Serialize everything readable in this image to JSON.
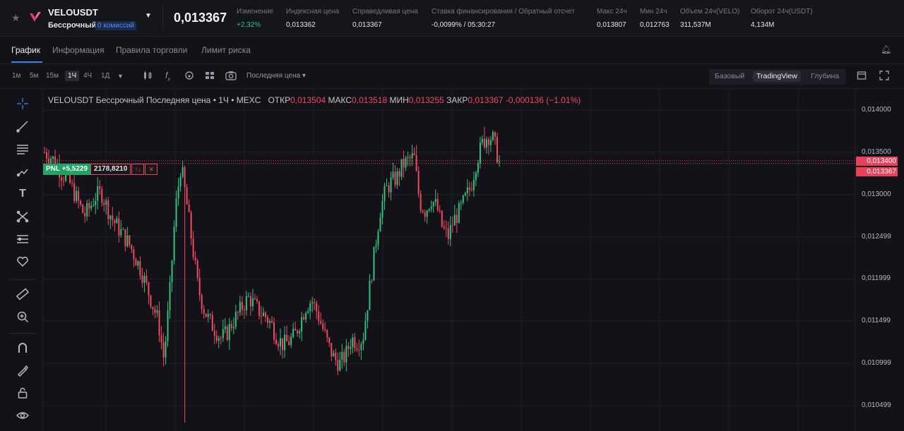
{
  "header": {
    "symbol": "VELOUSDT",
    "contract_type": "Бессрочный",
    "fee_badge": "0 комиссий",
    "last_price": "0,013367",
    "stats": [
      {
        "label": "Изменение",
        "value": "+2,32%",
        "color": "#2ec37f"
      },
      {
        "label": "Индексная цена",
        "value": "0,013362"
      },
      {
        "label": "Справедливая цена",
        "value": "0,013367"
      },
      {
        "label": "Ставка финансирования / Обратный отсчет",
        "value": "-0,0099% / 05:30:27"
      },
      {
        "label": "Макс 24ч",
        "value": "0,013807"
      },
      {
        "label": "Мин 24ч",
        "value": "0,012763"
      },
      {
        "label": "Объем 24ч(VELO)",
        "value": "311,537M"
      },
      {
        "label": "Оборот 24ч(USDT)",
        "value": "4,134M"
      }
    ]
  },
  "tabs": [
    "График",
    "Информация",
    "Правила торговли",
    "Лимит риска"
  ],
  "active_tab": "График",
  "timeframes": [
    "1м",
    "5м",
    "15м",
    "1Ч",
    "4Ч",
    "1Д"
  ],
  "active_timeframe": "1Ч",
  "price_type": "Последняя цена",
  "views": [
    "Базовый",
    "TradingView",
    "Глубина"
  ],
  "active_view": "TradingView",
  "legend": {
    "title": "VELOUSDT Бессрочный Последняя цена • 1Ч • MEXC",
    "open_label": "ОТКР",
    "open": "0,013504",
    "high_label": "МАКС",
    "high": "0,013518",
    "low_label": "МИН",
    "low": "0,013255",
    "close_label": "ЗАКР",
    "close": "0,013367",
    "change": "-0,000136 (−1.01%)"
  },
  "position": {
    "pnl": "PNL +5,5229",
    "qty": "2178,8210",
    "reverse_icon": "↑↓",
    "close_icon": "✕"
  },
  "price_tags": {
    "entry": "0,013400",
    "last": "0,013367"
  },
  "colors": {
    "up": "#2ec37f",
    "down": "#f2495f",
    "accent": "#3b82f6",
    "tag": "#e8425a"
  },
  "chart_data": {
    "type": "candlestick",
    "y_ticks": [
      "0,014000",
      "0,013500",
      "0,013000",
      "0,012499",
      "0,011999",
      "0,011499",
      "0,010999",
      "0,010499"
    ],
    "ylim": [
      0.0102,
      0.01425
    ],
    "entry_line": 0.0134,
    "last_line": 0.013367,
    "close_path": [
      0.0135,
      0.01345,
      0.01338,
      0.01325,
      0.0132,
      0.01305,
      0.0129,
      0.01275,
      0.01285,
      0.01298,
      0.01302,
      0.01285,
      0.0127,
      0.0126,
      0.0125,
      0.0124,
      0.01225,
      0.0121,
      0.0119,
      0.0117,
      0.0115,
      0.01105,
      0.0118,
      0.0128,
      0.01335,
      0.0129,
      0.0124,
      0.0119,
      0.01165,
      0.0115,
      0.0114,
      0.0113,
      0.01135,
      0.01148,
      0.01158,
      0.0117,
      0.01178,
      0.01168,
      0.0116,
      0.01155,
      0.01145,
      0.0113,
      0.01122,
      0.01126,
      0.01133,
      0.0115,
      0.01168,
      0.01175,
      0.0116,
      0.0114,
      0.0112,
      0.01105,
      0.011,
      0.0111,
      0.0113,
      0.01125,
      0.0113,
      0.0118,
      0.0123,
      0.0128,
      0.01305,
      0.01315,
      0.0132,
      0.01335,
      0.0134,
      0.01345,
      0.0129,
      0.0128,
      0.01295,
      0.01285,
      0.0126,
      0.0125,
      0.0127,
      0.0128,
      0.01295,
      0.0131,
      0.0134,
      0.0136,
      0.0137,
      0.01365,
      0.01337
    ]
  }
}
